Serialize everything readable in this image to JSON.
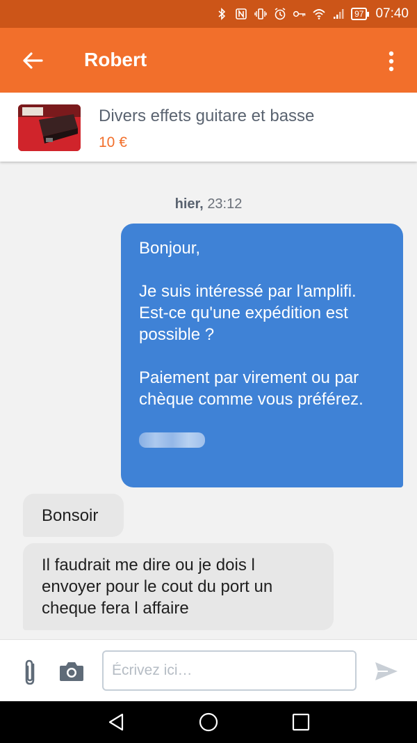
{
  "status_bar": {
    "battery": "97",
    "time": "07:40",
    "icons": [
      "bluetooth-icon",
      "nfc-icon",
      "vibrate-icon",
      "alarm-icon",
      "key-icon",
      "wifi-icon",
      "signal-icon",
      "battery-icon"
    ]
  },
  "app_bar": {
    "title": "Robert",
    "back_icon": "arrow-left-icon",
    "menu_icon": "more-vertical-icon"
  },
  "listing": {
    "title": "Divers effets guitare et basse",
    "price": "10 €"
  },
  "conversation": {
    "timestamp_day": "hier,",
    "timestamp_time": "23:12",
    "outgoing": {
      "greeting": "Bonjour,",
      "paragraph_1": "Je suis intéressé par l'amplifi. Est-ce qu'une expédition est possible ?",
      "paragraph_2": "Paiement par virement ou par chèque comme vous préférez."
    },
    "incoming": [
      {
        "text": "Bonsoir"
      },
      {
        "text": "Il faudrait me dire ou je dois l envoyer pour le cout du port un cheque fera l affaire"
      }
    ]
  },
  "composer": {
    "placeholder": "Écrivez ici…",
    "attach_icon": "paperclip-icon",
    "camera_icon": "camera-icon",
    "send_icon": "send-icon"
  },
  "nav_bar": {
    "icons": [
      "back-triangle-icon",
      "home-circle-icon",
      "recents-square-icon"
    ]
  },
  "colors": {
    "status_bar": "#cc5518",
    "app_bar": "#f26f2b",
    "outgoing_bubble": "#3f82d6",
    "incoming_bubble": "#e7e7e7",
    "price": "#f26f2b"
  }
}
